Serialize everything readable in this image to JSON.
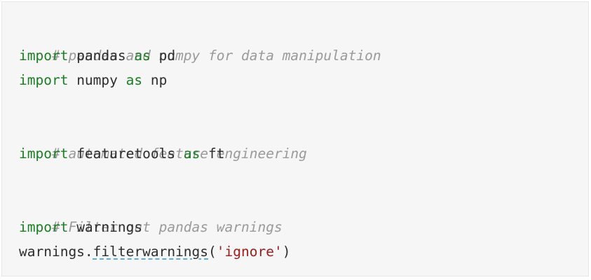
{
  "code": {
    "line1": {
      "comment": "# pandas and numpy for data manipulation"
    },
    "line2": {
      "kw1": "import",
      "mod": " pandas ",
      "kw2": "as",
      "alias": " pd"
    },
    "line3": {
      "kw1": "import",
      "mod": " numpy ",
      "kw2": "as",
      "alias": " np"
    },
    "line5": {
      "comment": "# automated feature engineering"
    },
    "line6": {
      "kw1": "import",
      "mod": " featuretools ",
      "kw2": "as",
      "alias": " ft"
    },
    "line8": {
      "comment": "# Filter out pandas warnings"
    },
    "line9": {
      "kw1": "import",
      "mod": " warnings"
    },
    "line10": {
      "obj": "warnings",
      "dot": ".",
      "method": "filterwarnings",
      "open": "(",
      "arg": "'ignore'",
      "close": ")"
    }
  }
}
